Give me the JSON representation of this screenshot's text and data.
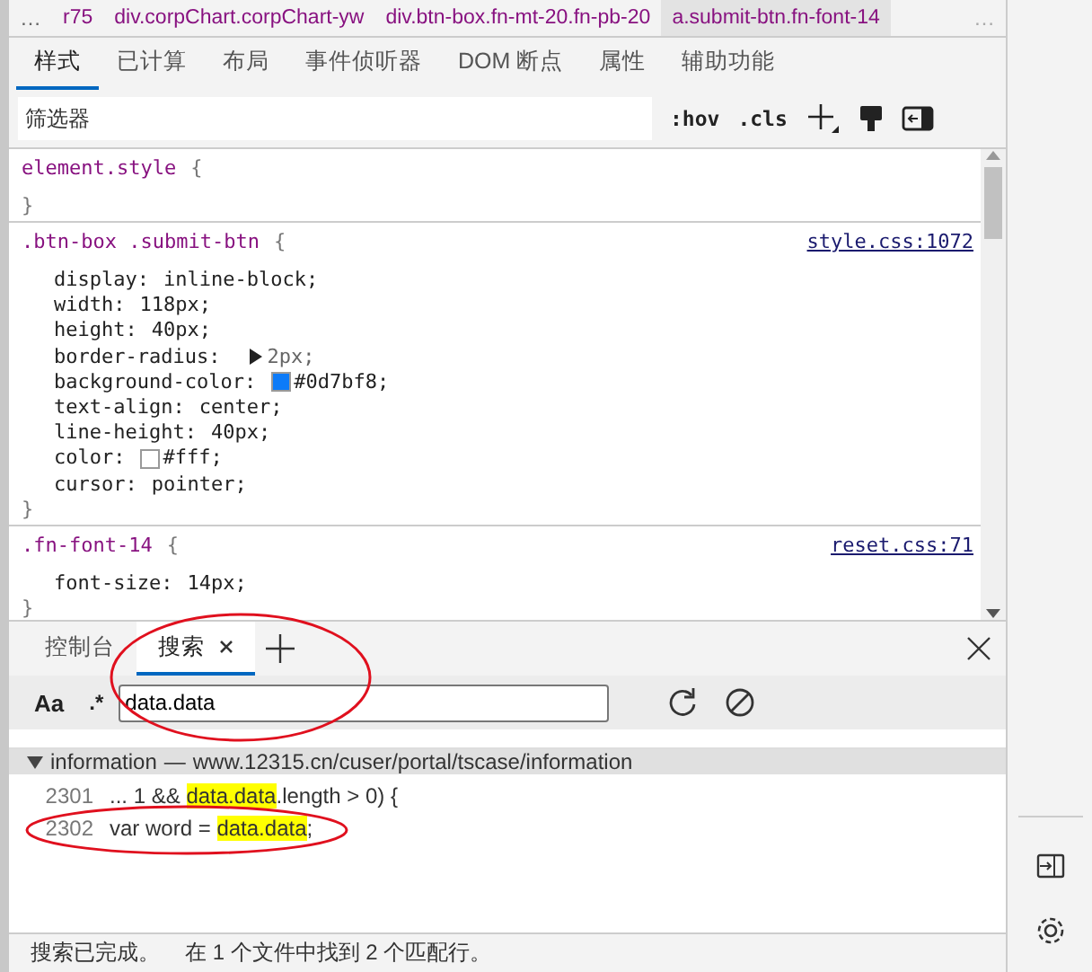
{
  "breadcrumbs": [
    {
      "label": "r75",
      "selected": false
    },
    {
      "label": "div.corpChart.corpChart-yw",
      "selected": false
    },
    {
      "label": "div.btn-box.fn-mt-20.fn-pb-20",
      "selected": false
    },
    {
      "label": "a.submit-btn.fn-font-14",
      "selected": true
    }
  ],
  "breadcrumb_overflow": [
    "…",
    "…"
  ],
  "tabs": [
    {
      "label": "样式",
      "selected": true
    },
    {
      "label": "已计算",
      "selected": false
    },
    {
      "label": "布局",
      "selected": false
    },
    {
      "label": "事件侦听器",
      "selected": false
    },
    {
      "label": "DOM 断点",
      "selected": false
    },
    {
      "label": "属性",
      "selected": false
    },
    {
      "label": "辅助功能",
      "selected": false
    }
  ],
  "filter": {
    "placeholder": "筛选器",
    "hov": ":hov",
    "cls": ".cls"
  },
  "rules": [
    {
      "selector": "element.style",
      "open": "{",
      "close": "}"
    },
    {
      "selector": ".btn-box .submit-btn",
      "open": "{",
      "close": "}",
      "source": "style.css:1072",
      "declarations": [
        {
          "name": "display:",
          "value": "inline-block;"
        },
        {
          "name": "width:",
          "value": "118px;"
        },
        {
          "name": "height:",
          "value": "40px;"
        },
        {
          "name": "border-radius:",
          "value": "2px;",
          "expandable": true
        },
        {
          "name": "background-color:",
          "value": "#0d7bf8;",
          "color": "#0d7bf8"
        },
        {
          "name": "text-align:",
          "value": "center;"
        },
        {
          "name": "line-height:",
          "value": "40px;"
        },
        {
          "name": "color:",
          "value": "#fff;",
          "color": "#ffffff"
        },
        {
          "name": "cursor:",
          "value": "pointer;"
        }
      ]
    },
    {
      "selector": ".fn-font-14",
      "open": "{",
      "close": "}",
      "source": "reset.css:71",
      "declarations": [
        {
          "name": "font-size:",
          "value": "14px;"
        }
      ]
    }
  ],
  "drawer_tabs": [
    {
      "label": "控制台",
      "selected": false,
      "closable": false
    },
    {
      "label": "搜索",
      "selected": true,
      "closable": true
    }
  ],
  "search": {
    "case_label": "Aa",
    "regex_label": ".*",
    "value": "data.data"
  },
  "result": {
    "file": "information",
    "separator": "—",
    "url": "www.12315.cn/cuser/portal/tscase/information",
    "lines": [
      {
        "number": "2301",
        "before": "... 1 && ",
        "match": "data.data",
        "after": ".length > 0) {"
      },
      {
        "number": "2302",
        "before": "var word = ",
        "match": "data.data",
        "after": ";"
      }
    ]
  },
  "status": {
    "done": "搜索已完成。",
    "summary": "在 1 个文件中找到 2 个匹配行。"
  }
}
